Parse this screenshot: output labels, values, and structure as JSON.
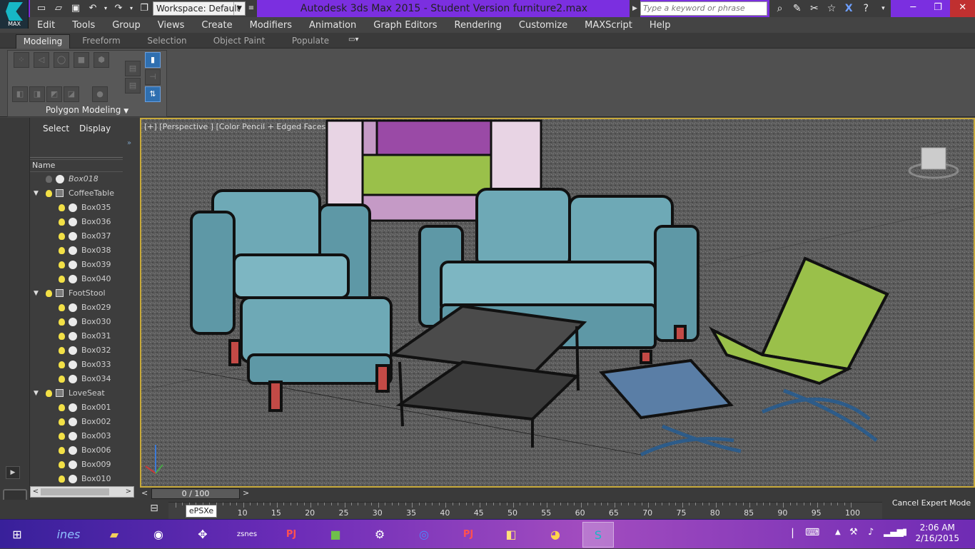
{
  "app": {
    "logo_text": "MAX",
    "title": "Autodesk 3ds Max  2015   - Student Version    furniture2.max",
    "workspace": "Workspace: Default",
    "search_placeholder": "Type a keyword or phrase"
  },
  "menu": [
    "Edit",
    "Tools",
    "Group",
    "Views",
    "Create",
    "Modifiers",
    "Animation",
    "Graph Editors",
    "Rendering",
    "Customize",
    "MAXScript",
    "Help"
  ],
  "ribbon": {
    "tabs": [
      "Modeling",
      "Freeform",
      "Selection",
      "Object Paint",
      "Populate"
    ],
    "active_tab": "Modeling",
    "panel_label": "Polygon Modeling"
  },
  "scene_explorer": {
    "tabs": [
      "Select",
      "Display"
    ],
    "column_header": "Name",
    "rows": [
      {
        "name": "Box018",
        "type": "object",
        "level": 0,
        "light": false,
        "italic": true
      },
      {
        "name": "CoffeeTable",
        "type": "group",
        "level": 0,
        "light": true
      },
      {
        "name": "Box035",
        "type": "object",
        "level": 1,
        "light": true
      },
      {
        "name": "Box036",
        "type": "object",
        "level": 1,
        "light": true
      },
      {
        "name": "Box037",
        "type": "object",
        "level": 1,
        "light": true
      },
      {
        "name": "Box038",
        "type": "object",
        "level": 1,
        "light": true
      },
      {
        "name": "Box039",
        "type": "object",
        "level": 1,
        "light": true
      },
      {
        "name": "Box040",
        "type": "object",
        "level": 1,
        "light": true
      },
      {
        "name": "FootStool",
        "type": "group",
        "level": 0,
        "light": true
      },
      {
        "name": "Box029",
        "type": "object",
        "level": 1,
        "light": true
      },
      {
        "name": "Box030",
        "type": "object",
        "level": 1,
        "light": true
      },
      {
        "name": "Box031",
        "type": "object",
        "level": 1,
        "light": true
      },
      {
        "name": "Box032",
        "type": "object",
        "level": 1,
        "light": true
      },
      {
        "name": "Box033",
        "type": "object",
        "level": 1,
        "light": true
      },
      {
        "name": "Box034",
        "type": "object",
        "level": 1,
        "light": true
      },
      {
        "name": "LoveSeat",
        "type": "group",
        "level": 0,
        "light": true
      },
      {
        "name": "Box001",
        "type": "object",
        "level": 1,
        "light": true
      },
      {
        "name": "Box002",
        "type": "object",
        "level": 1,
        "light": true
      },
      {
        "name": "Box003",
        "type": "object",
        "level": 1,
        "light": true
      },
      {
        "name": "Box006",
        "type": "object",
        "level": 1,
        "light": true
      },
      {
        "name": "Box009",
        "type": "object",
        "level": 1,
        "light": true
      },
      {
        "name": "Box010",
        "type": "object",
        "level": 1,
        "light": true
      }
    ]
  },
  "viewport": {
    "label": "[+] [Perspective ] [Color Pencil + Edged Faces ]",
    "gizmo_axes": [
      "x",
      "y",
      "z"
    ]
  },
  "timeline": {
    "frame_display": "0 / 100",
    "ticks": [
      "10",
      "15",
      "20",
      "25",
      "30",
      "35",
      "40",
      "45",
      "50",
      "55",
      "60",
      "65",
      "70",
      "75",
      "80",
      "85",
      "90",
      "95",
      "100"
    ],
    "tooltip": "ePSXe",
    "cancel_label": "Cancel Expert Mode"
  },
  "taskbar": {
    "apps": [
      "windows-start",
      "ines",
      "file-explorer",
      "steam",
      "gamepad",
      "zsnes",
      "project64",
      "minecraft",
      "app-gear",
      "app-circle",
      "project64-b",
      "folder-color",
      "chrome",
      "3ds-max"
    ],
    "zsnes_label": "zsnes",
    "ines_label": "ines",
    "pj_label": "PJ",
    "time": "2:06 AM",
    "date": "2/16/2015"
  },
  "colors": {
    "titlebar": "#7b2fe0",
    "viewport_border": "#c7a93a",
    "furniture_blue": "#6ea9b6",
    "furniture_green": "#9ac04a",
    "furniture_purple": "#9a4aa6",
    "leg_red": "#c34a46"
  }
}
